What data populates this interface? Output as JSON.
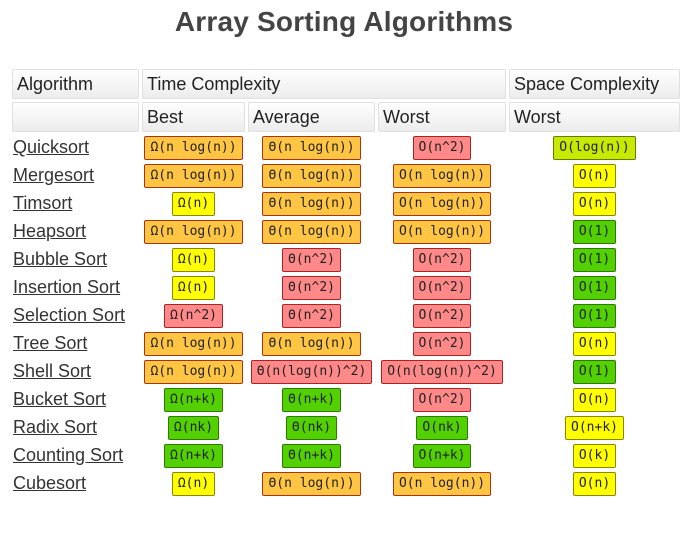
{
  "title": "Array Sorting Algorithms",
  "headers": {
    "row1": [
      "Algorithm",
      "Time Complexity",
      "Space Complexity"
    ],
    "row2": [
      "",
      "Best",
      "Average",
      "Worst",
      "Worst"
    ]
  },
  "colors": {
    "orange": "#ffc543",
    "red": "#ff8888",
    "yellow": "#ffff00",
    "green": "#53d000",
    "yellowgreen": "#c8ea00"
  },
  "rows": [
    {
      "name": "Quicksort",
      "best": {
        "v": "Ω(n log(n))",
        "c": "orange"
      },
      "avg": {
        "v": "Θ(n log(n))",
        "c": "orange"
      },
      "worst": {
        "v": "O(n^2)",
        "c": "red"
      },
      "space": {
        "v": "O(log(n))",
        "c": "yellowgreen"
      }
    },
    {
      "name": "Mergesort",
      "best": {
        "v": "Ω(n log(n))",
        "c": "orange"
      },
      "avg": {
        "v": "Θ(n log(n))",
        "c": "orange"
      },
      "worst": {
        "v": "O(n log(n))",
        "c": "orange"
      },
      "space": {
        "v": "O(n)",
        "c": "yellow"
      }
    },
    {
      "name": "Timsort",
      "best": {
        "v": "Ω(n)",
        "c": "yellow"
      },
      "avg": {
        "v": "Θ(n log(n))",
        "c": "orange"
      },
      "worst": {
        "v": "O(n log(n))",
        "c": "orange"
      },
      "space": {
        "v": "O(n)",
        "c": "yellow"
      }
    },
    {
      "name": "Heapsort",
      "best": {
        "v": "Ω(n log(n))",
        "c": "orange"
      },
      "avg": {
        "v": "Θ(n log(n))",
        "c": "orange"
      },
      "worst": {
        "v": "O(n log(n))",
        "c": "orange"
      },
      "space": {
        "v": "O(1)",
        "c": "green"
      }
    },
    {
      "name": "Bubble Sort",
      "best": {
        "v": "Ω(n)",
        "c": "yellow"
      },
      "avg": {
        "v": "Θ(n^2)",
        "c": "red"
      },
      "worst": {
        "v": "O(n^2)",
        "c": "red"
      },
      "space": {
        "v": "O(1)",
        "c": "green"
      }
    },
    {
      "name": "Insertion Sort",
      "best": {
        "v": "Ω(n)",
        "c": "yellow"
      },
      "avg": {
        "v": "Θ(n^2)",
        "c": "red"
      },
      "worst": {
        "v": "O(n^2)",
        "c": "red"
      },
      "space": {
        "v": "O(1)",
        "c": "green"
      }
    },
    {
      "name": "Selection Sort",
      "best": {
        "v": "Ω(n^2)",
        "c": "red"
      },
      "avg": {
        "v": "Θ(n^2)",
        "c": "red"
      },
      "worst": {
        "v": "O(n^2)",
        "c": "red"
      },
      "space": {
        "v": "O(1)",
        "c": "green"
      }
    },
    {
      "name": "Tree Sort",
      "best": {
        "v": "Ω(n log(n))",
        "c": "orange"
      },
      "avg": {
        "v": "Θ(n log(n))",
        "c": "orange"
      },
      "worst": {
        "v": "O(n^2)",
        "c": "red"
      },
      "space": {
        "v": "O(n)",
        "c": "yellow"
      }
    },
    {
      "name": "Shell Sort",
      "best": {
        "v": "Ω(n log(n))",
        "c": "orange"
      },
      "avg": {
        "v": "Θ(n(log(n))^2)",
        "c": "red"
      },
      "worst": {
        "v": "O(n(log(n))^2)",
        "c": "red"
      },
      "space": {
        "v": "O(1)",
        "c": "green"
      }
    },
    {
      "name": "Bucket Sort",
      "best": {
        "v": "Ω(n+k)",
        "c": "green"
      },
      "avg": {
        "v": "Θ(n+k)",
        "c": "green"
      },
      "worst": {
        "v": "O(n^2)",
        "c": "red"
      },
      "space": {
        "v": "O(n)",
        "c": "yellow"
      }
    },
    {
      "name": "Radix Sort",
      "best": {
        "v": "Ω(nk)",
        "c": "green"
      },
      "avg": {
        "v": "Θ(nk)",
        "c": "green"
      },
      "worst": {
        "v": "O(nk)",
        "c": "green"
      },
      "space": {
        "v": "O(n+k)",
        "c": "yellow"
      }
    },
    {
      "name": "Counting Sort",
      "best": {
        "v": "Ω(n+k)",
        "c": "green"
      },
      "avg": {
        "v": "Θ(n+k)",
        "c": "green"
      },
      "worst": {
        "v": "O(n+k)",
        "c": "green"
      },
      "space": {
        "v": "O(k)",
        "c": "yellow"
      }
    },
    {
      "name": "Cubesort",
      "best": {
        "v": "Ω(n)",
        "c": "yellow"
      },
      "avg": {
        "v": "Θ(n log(n))",
        "c": "orange"
      },
      "worst": {
        "v": "O(n log(n))",
        "c": "orange"
      },
      "space": {
        "v": "O(n)",
        "c": "yellow"
      }
    }
  ]
}
